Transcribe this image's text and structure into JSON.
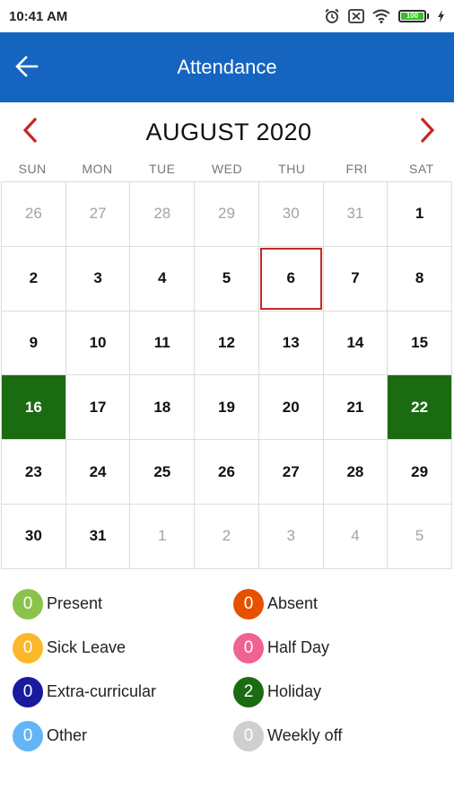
{
  "status_bar": {
    "time": "10:41 AM",
    "battery": "100"
  },
  "app_bar": {
    "title": "Attendance"
  },
  "calendar": {
    "month_label": "AUGUST 2020",
    "weekdays": [
      "SUN",
      "MON",
      "TUE",
      "WED",
      "THU",
      "FRI",
      "SAT"
    ],
    "days": [
      {
        "label": "26",
        "muted": true
      },
      {
        "label": "27",
        "muted": true
      },
      {
        "label": "28",
        "muted": true
      },
      {
        "label": "29",
        "muted": true
      },
      {
        "label": "30",
        "muted": true
      },
      {
        "label": "31",
        "muted": true
      },
      {
        "label": "1"
      },
      {
        "label": "2"
      },
      {
        "label": "3"
      },
      {
        "label": "4"
      },
      {
        "label": "5"
      },
      {
        "label": "6",
        "today": true
      },
      {
        "label": "7"
      },
      {
        "label": "8"
      },
      {
        "label": "9"
      },
      {
        "label": "10"
      },
      {
        "label": "11"
      },
      {
        "label": "12"
      },
      {
        "label": "13"
      },
      {
        "label": "14"
      },
      {
        "label": "15"
      },
      {
        "label": "16",
        "status": "holiday"
      },
      {
        "label": "17"
      },
      {
        "label": "18"
      },
      {
        "label": "19"
      },
      {
        "label": "20"
      },
      {
        "label": "21"
      },
      {
        "label": "22",
        "status": "holiday"
      },
      {
        "label": "23"
      },
      {
        "label": "24"
      },
      {
        "label": "25"
      },
      {
        "label": "26"
      },
      {
        "label": "27"
      },
      {
        "label": "28"
      },
      {
        "label": "29"
      },
      {
        "label": "30"
      },
      {
        "label": "31"
      },
      {
        "label": "1",
        "muted": true
      },
      {
        "label": "2",
        "muted": true
      },
      {
        "label": "3",
        "muted": true
      },
      {
        "label": "4",
        "muted": true
      },
      {
        "label": "5",
        "muted": true
      }
    ]
  },
  "legend": [
    {
      "count": "0",
      "label": "Present",
      "color": "#8bc34a"
    },
    {
      "count": "0",
      "label": "Absent",
      "color": "#e65100"
    },
    {
      "count": "0",
      "label": "Sick Leave",
      "color": "#fbb82b"
    },
    {
      "count": "0",
      "label": "Half Day",
      "color": "#f06292"
    },
    {
      "count": "0",
      "label": "Extra-curricular",
      "color": "#1a1a9e"
    },
    {
      "count": "2",
      "label": "Holiday",
      "color": "#1b6b13"
    },
    {
      "count": "0",
      "label": "Other",
      "color": "#64b5f6"
    },
    {
      "count": "0",
      "label": "Weekly off",
      "color": "#cfcfcf"
    }
  ],
  "colors": {
    "app_bar": "#1565c0",
    "nav_arrow": "#c62828",
    "holiday": "#1b6b13",
    "today_outline": "#c62828"
  },
  "icons": {
    "back": "arrow-left-icon",
    "prev_month": "chevron-left-icon",
    "next_month": "chevron-right-icon",
    "alarm": "alarm-icon",
    "notification_off": "dnd-box-icon",
    "wifi": "wifi-icon",
    "battery": "battery-icon",
    "charging": "charging-bolt-icon"
  }
}
